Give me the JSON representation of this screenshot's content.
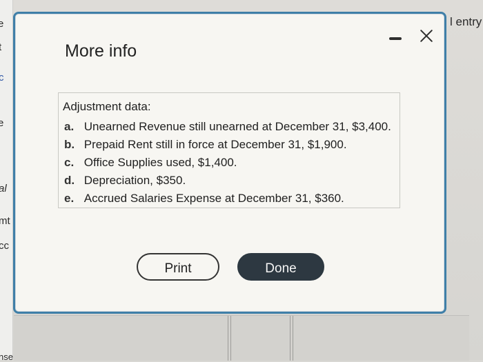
{
  "background": {
    "left_fragments": [
      "e",
      "t",
      "c",
      "e",
      "al",
      "mt",
      "cc",
      "nse"
    ],
    "right_fragment": "l entry"
  },
  "modal": {
    "title": "More info",
    "controls": {
      "minimize_icon": "minus-icon",
      "close_icon": "close-icon"
    },
    "info": {
      "heading": "Adjustment data:",
      "items": [
        {
          "letter": "a.",
          "text": "Unearned Revenue still unearned at December 31, $3,400."
        },
        {
          "letter": "b.",
          "text": "Prepaid Rent still in force at December 31, $1,900."
        },
        {
          "letter": "c.",
          "text": "Office Supplies used, $1,400."
        },
        {
          "letter": "d.",
          "text": "Depreciation, $350."
        },
        {
          "letter": "e.",
          "text": "Accrued Salaries Expense at December 31, $360."
        }
      ]
    },
    "buttons": {
      "print": "Print",
      "done": "Done"
    }
  }
}
